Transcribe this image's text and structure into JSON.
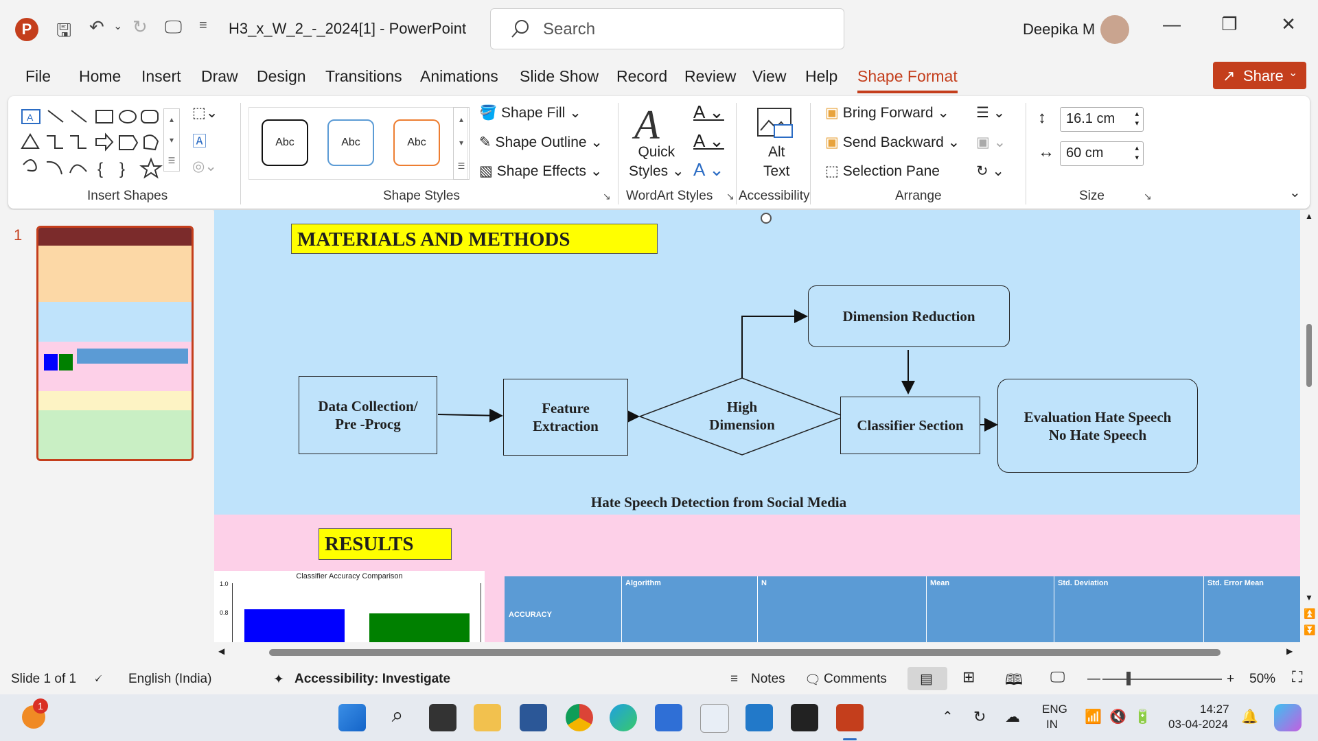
{
  "titlebar": {
    "doc_title": "H3_x_W_2_-_2024[1]  -  PowerPoint",
    "search_placeholder": "Search",
    "user_name": "Deepika M"
  },
  "tabs": [
    "File",
    "Home",
    "Insert",
    "Draw",
    "Design",
    "Transitions",
    "Animations",
    "Slide Show",
    "Record",
    "Review",
    "View",
    "Help",
    "Shape Format"
  ],
  "active_tab": "Shape Format",
  "share_label": "Share",
  "ribbon": {
    "groups": {
      "insert_shapes": "Insert Shapes",
      "shape_styles": "Shape Styles",
      "wordart_styles": "WordArt Styles",
      "accessibility": "Accessibility",
      "arrange": "Arrange",
      "size": "Size"
    },
    "style_samples": [
      "Abc",
      "Abc",
      "Abc"
    ],
    "shape_fill": "Shape Fill",
    "shape_outline": "Shape Outline",
    "shape_effects": "Shape Effects",
    "quick_styles": [
      "Quick",
      "Styles"
    ],
    "alt_text": [
      "Alt",
      "Text"
    ],
    "bring_forward": "Bring Forward",
    "send_backward": "Send Backward",
    "selection_pane": "Selection Pane",
    "height": "16.1 cm",
    "width": "60 cm"
  },
  "slide_pane": {
    "slide_number": "1"
  },
  "slide": {
    "materials_title": "MATERIALS AND METHODS",
    "flow": {
      "data_collection": [
        "Data Collection/",
        "Pre -Procg"
      ],
      "feature_extraction": [
        "Feature",
        "Extraction"
      ],
      "high_dimension": [
        "High",
        "Dimension"
      ],
      "dimension_reduction": "Dimension Reduction",
      "classifier_section": "Classifier Section",
      "evaluation": [
        "Evaluation Hate Speech",
        "No Hate Speech"
      ]
    },
    "caption": "Hate Speech Detection from Social Media",
    "results_title": "RESULTS",
    "chart_title": "Classifier Accuracy Comparison",
    "chart_ticks": [
      "1.0",
      "0.8"
    ],
    "table_headers": [
      "Algorithm",
      "N",
      "Mean",
      "Std. Deviation",
      "Std. Error Mean"
    ],
    "table_row_label": "ACCURACY"
  },
  "chart_data": {
    "type": "bar",
    "title": "Classifier Accuracy Comparison",
    "ylim": [
      0.8,
      1.0
    ],
    "categories": [
      "",
      ""
    ],
    "values": [
      0.82,
      0.79
    ],
    "colors": [
      "#0000ff",
      "#008000"
    ]
  },
  "statusbar": {
    "slide_info": "Slide 1 of 1",
    "language": "English (India)",
    "accessibility": "Accessibility: Investigate",
    "notes": "Notes",
    "comments": "Comments",
    "zoom": "50%"
  },
  "taskbar": {
    "lang1": "ENG",
    "lang2": "IN",
    "time": "14:27",
    "date": "03-04-2024",
    "notification_badge": "1"
  }
}
